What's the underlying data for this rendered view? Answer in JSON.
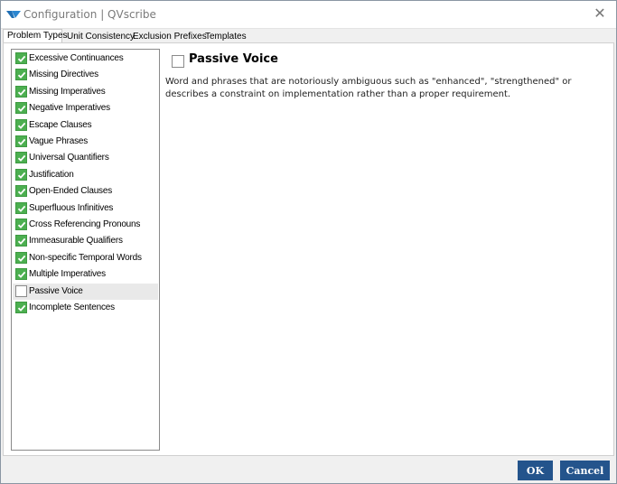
{
  "window": {
    "title": "Configuration | QVscribe",
    "close_glyph": "✕"
  },
  "tabs": [
    {
      "label": "Problem Types",
      "active": true
    },
    {
      "label": "Unit Consistency",
      "active": false
    },
    {
      "label": "Exclusion Prefixes",
      "active": false
    },
    {
      "label": "Templates",
      "active": false
    }
  ],
  "problem_types": [
    {
      "label": "Excessive Continuances",
      "checked": true
    },
    {
      "label": "Missing Directives",
      "checked": true
    },
    {
      "label": "Missing Imperatives",
      "checked": true
    },
    {
      "label": "Negative Imperatives",
      "checked": true
    },
    {
      "label": "Escape Clauses",
      "checked": true
    },
    {
      "label": "Vague Phrases",
      "checked": true
    },
    {
      "label": "Universal Quantifiers",
      "checked": true
    },
    {
      "label": "Justification",
      "checked": true
    },
    {
      "label": "Open-Ended Clauses",
      "checked": true
    },
    {
      "label": "Superfluous Infinitives",
      "checked": true
    },
    {
      "label": "Cross Referencing Pronouns",
      "checked": true
    },
    {
      "label": "Immeasurable Qualifiers",
      "checked": true
    },
    {
      "label": "Non-specific Temporal Words",
      "checked": true
    },
    {
      "label": "Multiple Imperatives",
      "checked": true
    },
    {
      "label": "Passive Voice",
      "checked": false,
      "selected": true
    },
    {
      "label": "Incomplete Sentences",
      "checked": true
    }
  ],
  "detail": {
    "title": "Passive Voice",
    "checked": false,
    "description": "Word and phrases that are notoriously ambiguous such as \"enhanced\", \"strengthened\" or describes a constraint on implementation rather than a proper requirement."
  },
  "footer": {
    "ok_label": "OK",
    "cancel_label": "Cancel"
  },
  "colors": {
    "check_green": "#4caf50",
    "button_blue": "#24548c",
    "selected_row": "#e9e9e9"
  }
}
